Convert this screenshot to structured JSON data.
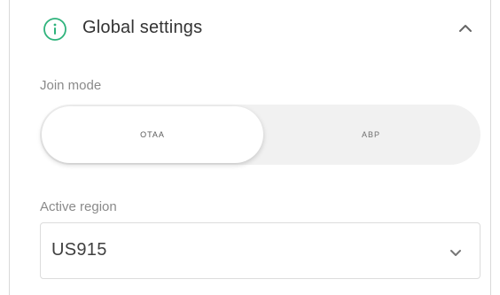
{
  "header": {
    "title": "Global settings",
    "icon": "info-icon",
    "collapse_icon": "chevron-up-icon"
  },
  "join_mode": {
    "label": "Join mode",
    "options": [
      "OTAA",
      "ABP"
    ],
    "selected": "OTAA"
  },
  "region": {
    "label": "Active region",
    "value": "US915",
    "icon": "chevron-down-icon"
  },
  "colors": {
    "accent": "#2fb37c",
    "segment_bg": "#f1f1f1"
  }
}
